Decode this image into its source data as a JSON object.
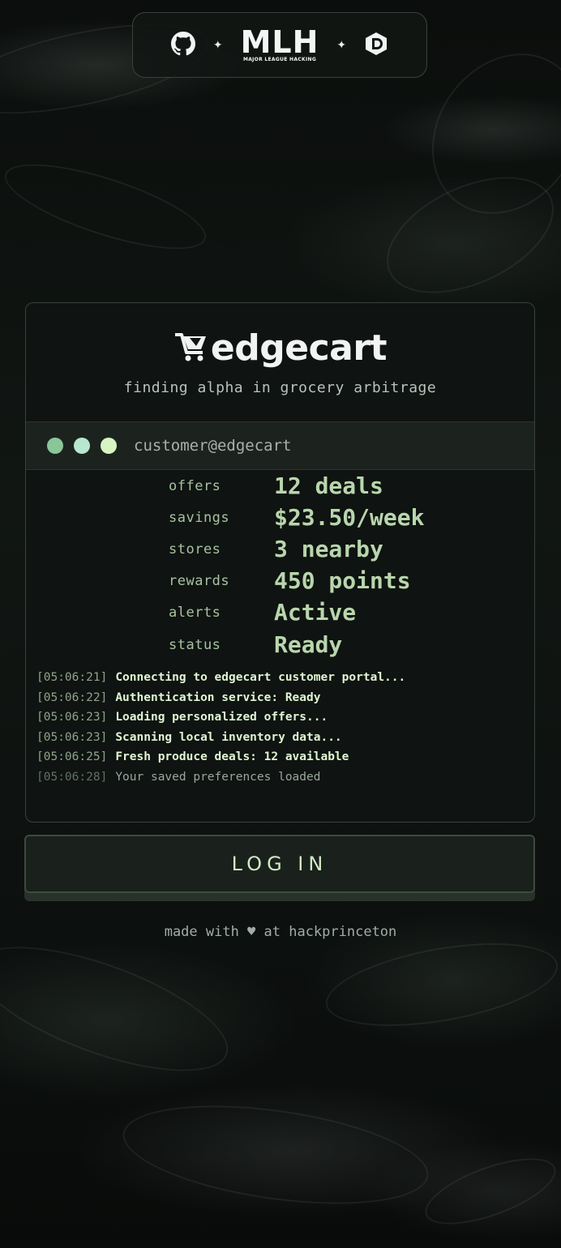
{
  "sponsors": {
    "github_icon": "github-icon",
    "mlh": {
      "main": "MLH",
      "sub": "MAJOR LEAGUE HACKING"
    },
    "dlogo_icon": "d-logo-icon",
    "separator": "✦"
  },
  "brand": {
    "name": "edgecart",
    "cart_icon": "cart-icon",
    "tagline": "finding alpha in grocery arbitrage"
  },
  "terminal": {
    "user": "customer@edgecart",
    "dot_colors": [
      "#8bc69a",
      "#b9e6cf",
      "#d6f5c2"
    ]
  },
  "stats": [
    {
      "label": "offers",
      "value": "12 deals"
    },
    {
      "label": "savings",
      "value": "$23.50/week"
    },
    {
      "label": "stores",
      "value": "3 nearby"
    },
    {
      "label": "rewards",
      "value": "450 points"
    },
    {
      "label": "alerts",
      "value": "Active"
    },
    {
      "label": "status",
      "value": "Ready"
    }
  ],
  "log": [
    {
      "ts": "[05:06:21]",
      "msg": "Connecting to edgecart customer portal..."
    },
    {
      "ts": "[05:06:22]",
      "msg": "Authentication service: Ready"
    },
    {
      "ts": "[05:06:23]",
      "msg": "Loading personalized offers..."
    },
    {
      "ts": "[05:06:23]",
      "msg": "Scanning local inventory data..."
    },
    {
      "ts": "[05:06:25]",
      "msg": "Fresh produce deals: 12 available"
    },
    {
      "ts": "[05:06:28]",
      "msg": "Your saved preferences loaded"
    }
  ],
  "login": {
    "label": "LOG IN"
  },
  "footer": {
    "text": "made with ♥ at hackprinceton"
  }
}
